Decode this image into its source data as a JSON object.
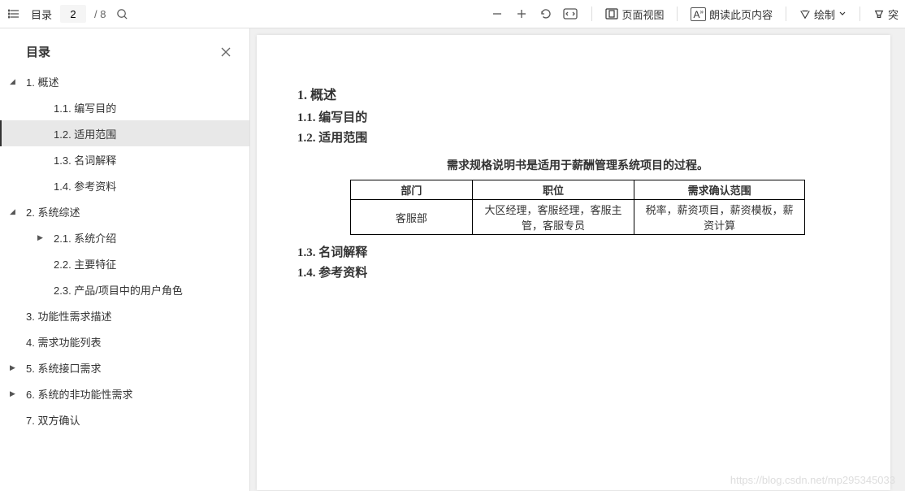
{
  "toolbar": {
    "toc_label": "目录",
    "page_current": "2",
    "page_total": "/ 8",
    "page_view_label": "页面视图",
    "read_aloud_label": "朗读此页内容",
    "draw_label": "绘制",
    "highlight_label": "突"
  },
  "sidebar": {
    "title": "目录",
    "items": [
      {
        "label": "1. 概述",
        "level": 1,
        "expanded": true
      },
      {
        "label": "1.1. 编写目的",
        "level": 2,
        "expanded": null
      },
      {
        "label": "1.2. 适用范围",
        "level": 2,
        "expanded": null,
        "selected": true
      },
      {
        "label": "1.3. 名词解释",
        "level": 2,
        "expanded": null
      },
      {
        "label": "1.4. 参考资料",
        "level": 2,
        "expanded": null
      },
      {
        "label": "2. 系统综述",
        "level": 1,
        "expanded": true
      },
      {
        "label": "2.1. 系统介绍",
        "level": 2,
        "expanded": false
      },
      {
        "label": "2.2. 主要特征",
        "level": 2,
        "expanded": null
      },
      {
        "label": "2.3. 产品/项目中的用户角色",
        "level": 2,
        "expanded": null
      },
      {
        "label": "3. 功能性需求描述",
        "level": 1,
        "expanded": null
      },
      {
        "label": "4. 需求功能列表",
        "level": 1,
        "expanded": null
      },
      {
        "label": "5. 系统接口需求",
        "level": 1,
        "expanded": false
      },
      {
        "label": "6. 系统的非功能性需求",
        "level": 1,
        "expanded": false
      },
      {
        "label": "7. 双方确认",
        "level": 1,
        "expanded": null
      }
    ]
  },
  "document": {
    "h1": "1.  概述",
    "h2_1": "1.1.  编写目的",
    "h2_2": "1.2.  适用范围",
    "center_text": "需求规格说明书是适用于薪酬管理系统项目的过程。",
    "table": {
      "headers": [
        "部门",
        "职位",
        "需求确认范围"
      ],
      "row": [
        "客服部",
        "大区经理，客服经理，客服主管，客服专员",
        "税率，薪资项目，薪资模板，薪资计算"
      ]
    },
    "h2_3": "1.3.  名词解释",
    "h2_4": "1.4.  参考资料"
  },
  "watermark": "https://blog.csdn.net/mp295345033"
}
